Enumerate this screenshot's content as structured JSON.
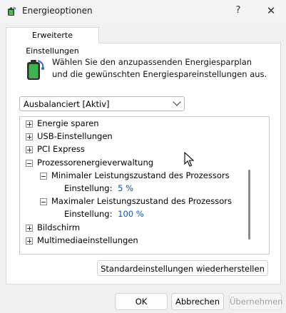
{
  "window": {
    "title": "Energieoptionen",
    "help_label": "?",
    "close_label": "✕"
  },
  "tab": {
    "label": "Erweiterte Einstellungen"
  },
  "description": "Wählen Sie den anzupassenden Energiesparplan und die gewünschten Energiespareinstellungen aus.",
  "plan_select": {
    "value": "Ausbalanciert [Aktiv]"
  },
  "tree": {
    "items": [
      {
        "label": "Energie sparen",
        "state": "collapsed"
      },
      {
        "label": "USB-Einstellungen",
        "state": "collapsed"
      },
      {
        "label": "PCI Express",
        "state": "collapsed"
      },
      {
        "label": "Prozessorenergieverwaltung",
        "state": "expanded"
      },
      {
        "label": "Minimaler Leistungszustand des Prozessors",
        "state": "expanded"
      },
      {
        "label": "Einstellung:",
        "value": "5 %"
      },
      {
        "label": "Maximaler Leistungszustand des Prozessors",
        "state": "expanded"
      },
      {
        "label": "Einstellung:",
        "value": "100 %"
      },
      {
        "label": "Bildschirm",
        "state": "collapsed"
      },
      {
        "label": "Multimediaeinstellungen",
        "state": "collapsed"
      }
    ]
  },
  "buttons": {
    "restore": "Standardeinstellungen wiederherstellen",
    "ok": "OK",
    "cancel": "Abbrechen",
    "apply": "Übernehmen"
  },
  "colors": {
    "value_text": "#0a58b8",
    "battery_green": "#3fb34f"
  }
}
